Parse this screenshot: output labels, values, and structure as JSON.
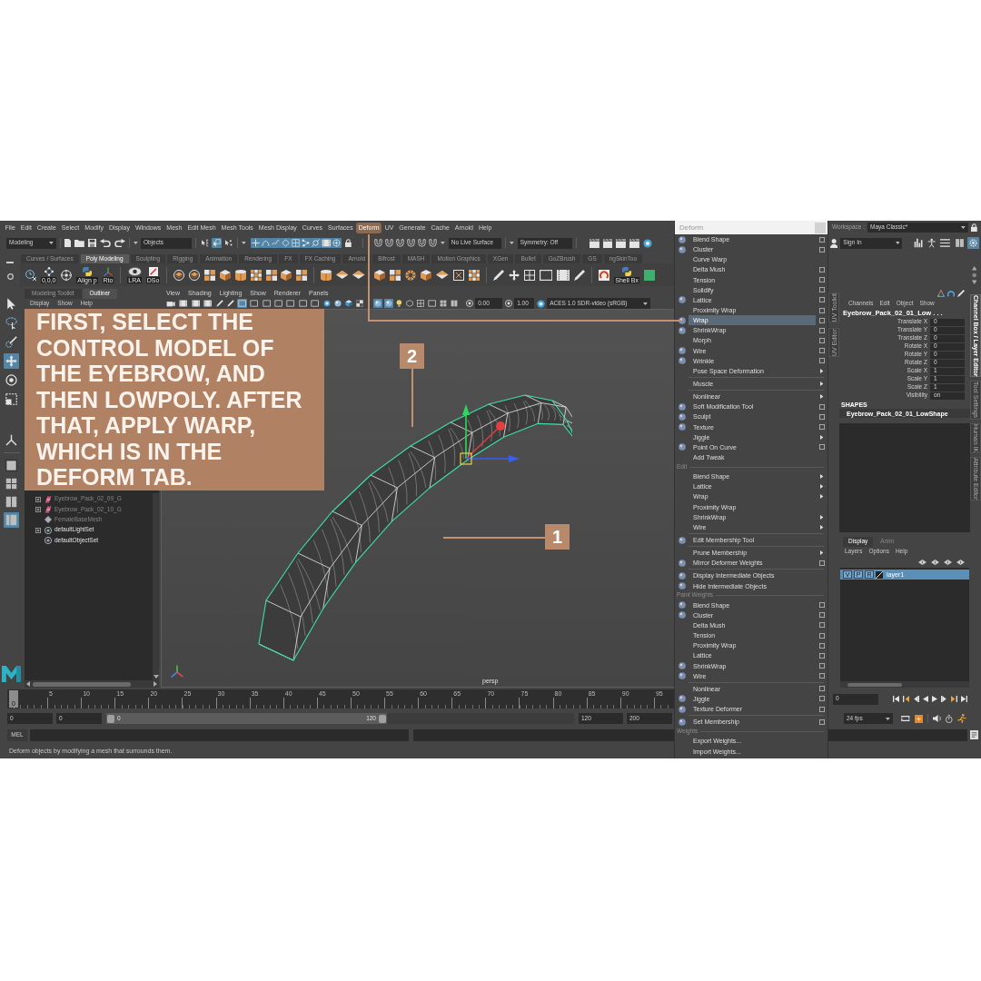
{
  "menu_bar": {
    "items": [
      {
        "label": "File",
        "selected": false
      },
      {
        "label": "Edit",
        "selected": false
      },
      {
        "label": "Create",
        "selected": false
      },
      {
        "label": "Select",
        "selected": false
      },
      {
        "label": "Modify",
        "selected": false
      },
      {
        "label": "Display",
        "selected": false
      },
      {
        "label": "Windows",
        "selected": false
      },
      {
        "label": "Mesh",
        "selected": false
      },
      {
        "label": "Edit Mesh",
        "selected": false
      },
      {
        "label": "Mesh Tools",
        "selected": false
      },
      {
        "label": "Mesh Display",
        "selected": false
      },
      {
        "label": "Curves",
        "selected": false
      },
      {
        "label": "Surfaces",
        "selected": false
      },
      {
        "label": "Deform",
        "selected": true
      },
      {
        "label": "UV",
        "selected": false
      },
      {
        "label": "Generate",
        "selected": false
      },
      {
        "label": "Cache",
        "selected": false
      },
      {
        "label": "Arnold",
        "selected": false
      },
      {
        "label": "Help",
        "selected": false
      }
    ]
  },
  "workspace": {
    "label": "Workspace :",
    "value": "Maya Classic*"
  },
  "status_line": {
    "mode": "Modeling",
    "select_mode": "Objects",
    "pick_modes": [
      {
        "selected": false
      },
      {
        "selected": true
      },
      {
        "selected": false
      }
    ],
    "masks": [
      {
        "on": true
      },
      {
        "on": true
      },
      {
        "on": true
      },
      {
        "on": true
      },
      {
        "on": true
      },
      {
        "on": true
      },
      {
        "on": true
      },
      {
        "on": true
      },
      {
        "on": true
      }
    ],
    "live_surface": "No Live Surface",
    "symmetry": "Symmetry: Off",
    "sign_in": "Sign In",
    "panel_toggles": [
      {
        "on": false
      },
      {
        "on": false
      },
      {
        "on": false
      },
      {
        "on": false
      },
      {
        "on": true
      }
    ]
  },
  "shelf": {
    "tabs": [
      {
        "label": "Curves / Surfaces",
        "selected": false
      },
      {
        "label": "Poly Modeling",
        "selected": true
      },
      {
        "label": "Sculpting",
        "selected": false
      },
      {
        "label": "Rigging",
        "selected": false
      },
      {
        "label": "Animation",
        "selected": false
      },
      {
        "label": "Rendering",
        "selected": false
      },
      {
        "label": "FX",
        "selected": false
      },
      {
        "label": "FX Caching",
        "selected": false
      },
      {
        "label": "Arnold",
        "selected": false
      },
      {
        "label": "Bifrost",
        "selected": false
      },
      {
        "label": "MASH",
        "selected": false
      },
      {
        "label": "Motion Graphics",
        "selected": false
      },
      {
        "label": "XGen",
        "selected": false
      },
      {
        "label": "Bullet",
        "selected": false
      },
      {
        "label": "GoZBrush",
        "selected": false
      },
      {
        "label": "GS",
        "selected": false
      },
      {
        "label": "ngSkinToo",
        "selected": false
      }
    ],
    "tool_labels": [
      "0,0,0",
      "Align p",
      "Rto",
      "LRA",
      "DSo",
      "Shell Bx"
    ]
  },
  "toolbox": {
    "tools": [
      {
        "selected": false
      },
      {
        "selected": false
      },
      {
        "selected": false
      },
      {
        "selected": true
      },
      {
        "selected": false
      },
      {
        "selected": false
      },
      {
        "selected": false
      }
    ],
    "layouts": [
      {
        "selected": false
      },
      {
        "selected": false
      },
      {
        "selected": false
      },
      {
        "selected": true
      }
    ]
  },
  "outliner": {
    "tabs": [
      {
        "label": "Modeling Toolkit",
        "selected": false
      },
      {
        "label": "Outliner",
        "selected": true
      }
    ],
    "menu": [
      "Display",
      "Show",
      "Help"
    ],
    "items": [
      {
        "label": "Eyebrow_Pack_02_09_G",
        "kind": "group",
        "dimmed": true,
        "expanded": false
      },
      {
        "label": "Eyebrow_Pack_02_10_G",
        "kind": "group",
        "dimmed": true,
        "expanded": false
      },
      {
        "label": "FemaleBaseMesh",
        "kind": "mesh",
        "dimmed": true
      },
      {
        "label": "defaultLightSet",
        "kind": "set",
        "dimmed": false,
        "expanded": false
      },
      {
        "label": "defaultObjectSet",
        "kind": "set",
        "dimmed": false
      }
    ]
  },
  "viewport": {
    "menu": [
      "View",
      "Shading",
      "Lighting",
      "Show",
      "Renderer",
      "Panels"
    ],
    "toolbar": [
      {
        "on": false
      },
      {
        "on": false
      },
      {
        "on": false
      },
      {
        "on": false
      },
      {
        "on": false
      },
      {
        "on": false
      },
      {
        "on": true
      },
      {
        "on": false
      },
      {
        "on": false
      },
      {
        "on": false
      },
      {
        "on": false
      },
      {
        "on": false
      },
      {
        "on": false
      },
      {
        "on": false
      },
      {
        "on": false
      },
      {
        "on": false
      },
      {
        "on": false
      },
      {
        "on": true
      },
      {
        "on": true
      },
      {
        "on": false
      },
      {
        "on": false
      },
      {
        "on": false
      },
      {
        "on": false
      },
      {
        "on": false
      },
      {
        "on": false
      }
    ],
    "exposure": "0.00",
    "gamma": "1.00",
    "color_space": "ACES 1.0 SDR-video (sRGB)",
    "camera": "persp"
  },
  "instruction": "FIRST, SELECT THE CONTROL MODEL OF THE EYEBROW, AND THEN LOWPOLY. AFTER THAT, APPLY WARP, WHICH IS IN THE DEFORM TAB.",
  "callouts": [
    {
      "label": "2"
    },
    {
      "label": "1"
    }
  ],
  "deform_menu": {
    "title": "Deform",
    "sections": [
      {
        "groups": [
          {
            "items": [
              {
                "label": "Blend Shape",
                "kind": "option",
                "icon": true,
                "selected": false
              },
              {
                "label": "Cluster",
                "kind": "option",
                "icon": true,
                "selected": false
              },
              {
                "label": "Curve Warp",
                "kind": "action",
                "selected": false
              },
              {
                "label": "Delta Mush",
                "kind": "option",
                "selected": false
              },
              {
                "label": "Tension",
                "kind": "option",
                "selected": false
              },
              {
                "label": "Solidify",
                "kind": "option",
                "selected": false
              },
              {
                "label": "Lattice",
                "kind": "option",
                "icon": true,
                "selected": false
              },
              {
                "label": "Proximity Wrap",
                "kind": "option",
                "selected": false
              },
              {
                "label": "Wrap",
                "kind": "option",
                "icon": true,
                "selected": true
              },
              {
                "label": "ShrinkWrap",
                "kind": "option",
                "icon": true,
                "selected": false
              },
              {
                "label": "Morph",
                "kind": "option",
                "selected": false
              },
              {
                "label": "Wire",
                "kind": "option",
                "icon": true,
                "selected": false
              },
              {
                "label": "Wrinkle",
                "kind": "option",
                "icon": true,
                "selected": false
              },
              {
                "label": "Pose Space Deformation",
                "kind": "submenu",
                "selected": false
              }
            ]
          },
          {
            "items": [
              {
                "label": "Muscle",
                "kind": "submenu",
                "selected": false
              }
            ]
          },
          {
            "items": [
              {
                "label": "Nonlinear",
                "kind": "submenu",
                "selected": false
              },
              {
                "label": "Soft Modification Tool",
                "kind": "option",
                "icon": true,
                "selected": false
              },
              {
                "label": "Sculpt",
                "kind": "option",
                "icon": true,
                "selected": false
              },
              {
                "label": "Texture",
                "kind": "option",
                "icon": true,
                "selected": false
              },
              {
                "label": "Jiggle",
                "kind": "submenu",
                "selected": false
              },
              {
                "label": "Point On Curve",
                "kind": "option",
                "icon": true,
                "selected": false
              },
              {
                "label": "Add Tweak",
                "kind": "action",
                "selected": false
              }
            ]
          }
        ]
      },
      {
        "heading": "Edit",
        "groups": [
          {
            "items": [
              {
                "label": "Blend Shape",
                "kind": "submenu",
                "selected": false
              },
              {
                "label": "Lattice",
                "kind": "submenu",
                "selected": false
              },
              {
                "label": "Wrap",
                "kind": "submenu",
                "selected": false
              },
              {
                "label": "Proximity Wrap",
                "kind": "action",
                "selected": false
              },
              {
                "label": "ShrinkWrap",
                "kind": "submenu",
                "selected": false
              },
              {
                "label": "Wire",
                "kind": "submenu",
                "selected": false
              }
            ]
          },
          {
            "items": [
              {
                "label": "Edit Membership Tool",
                "kind": "action",
                "icon": true,
                "selected": false
              }
            ]
          },
          {
            "items": [
              {
                "label": "Prune Membership",
                "kind": "submenu",
                "selected": false
              },
              {
                "label": "Mirror Deformer Weights",
                "kind": "option",
                "icon": true,
                "selected": false
              }
            ]
          },
          {
            "items": [
              {
                "label": "Display Intermediate Objects",
                "kind": "action",
                "icon": true,
                "selected": false
              },
              {
                "label": "Hide Intermediate Objects",
                "kind": "action",
                "icon": true,
                "selected": false
              }
            ]
          }
        ]
      },
      {
        "heading": "Paint Weights",
        "groups": [
          {
            "items": [
              {
                "label": "Blend Shape",
                "kind": "option",
                "icon": true,
                "selected": false
              },
              {
                "label": "Cluster",
                "kind": "option",
                "icon": true,
                "selected": false
              },
              {
                "label": "Delta Mush",
                "kind": "option",
                "selected": false
              },
              {
                "label": "Tension",
                "kind": "option",
                "selected": false
              },
              {
                "label": "Proximity Wrap",
                "kind": "option",
                "selected": false
              },
              {
                "label": "Lattice",
                "kind": "option",
                "selected": false
              },
              {
                "label": "ShrinkWrap",
                "kind": "option",
                "icon": true,
                "selected": false
              },
              {
                "label": "Wire",
                "kind": "option",
                "icon": true,
                "selected": false
              }
            ]
          },
          {
            "items": [
              {
                "label": "Nonlinear",
                "kind": "option",
                "selected": false
              },
              {
                "label": "Jiggle",
                "kind": "option",
                "icon": true,
                "selected": false
              },
              {
                "label": "Texture Deformer",
                "kind": "option",
                "icon": true,
                "selected": false
              }
            ]
          },
          {
            "items": [
              {
                "label": "Set Membership",
                "kind": "option",
                "icon": true,
                "selected": false
              }
            ]
          }
        ]
      },
      {
        "heading": "Weights",
        "groups": [
          {
            "items": [
              {
                "label": "Export Weights...",
                "kind": "action",
                "selected": false
              },
              {
                "label": "Import Weights...",
                "kind": "action",
                "selected": false
              }
            ]
          }
        ]
      }
    ]
  },
  "channel_box": {
    "left_tabs": [
      {
        "label": "UV Toolkit",
        "selected": false
      },
      {
        "label": "UV Editor",
        "selected": false
      }
    ],
    "right_tabs": [
      {
        "label": "Channel Box / Layer Editor",
        "selected": true
      },
      {
        "label": "Tool Settings",
        "selected": false
      },
      {
        "label": "Human IK",
        "selected": false
      },
      {
        "label": "Attribute Editor",
        "selected": false
      }
    ],
    "menu": [
      "Channels",
      "Edit",
      "Object",
      "Show"
    ],
    "object": "Eyebrow_Pack_02_01_Low . . .",
    "attributes": [
      {
        "name": "Translate X",
        "value": "0"
      },
      {
        "name": "Translate Y",
        "value": "0"
      },
      {
        "name": "Translate Z",
        "value": "0"
      },
      {
        "name": "Rotate X",
        "value": "0"
      },
      {
        "name": "Rotate Y",
        "value": "0"
      },
      {
        "name": "Rotate Z",
        "value": "0"
      },
      {
        "name": "Scale X",
        "value": "1"
      },
      {
        "name": "Scale Y",
        "value": "1"
      },
      {
        "name": "Scale Z",
        "value": "1"
      },
      {
        "name": "Visibility",
        "value": "on"
      }
    ],
    "shapes_heading": "SHAPES",
    "shape": "Eyebrow_Pack_02_01_LowShape"
  },
  "layer_editor": {
    "tabs": [
      {
        "label": "Display",
        "selected": true
      },
      {
        "label": "Anim",
        "selected": false
      }
    ],
    "menu": [
      "Layers",
      "Options",
      "Help"
    ],
    "layers": [
      {
        "name": "layer1",
        "selected": true,
        "toggles": [
          "V",
          "P",
          "R"
        ]
      }
    ]
  },
  "time_slider": {
    "current_frame": "0",
    "level": 0,
    "labels": [
      "5",
      "10",
      "15",
      "20",
      "25",
      "30",
      "35",
      "40",
      "45",
      "50",
      "55",
      "60",
      "65",
      "70",
      "75",
      "80",
      "85",
      "90",
      "95"
    ],
    "frame_field": "0"
  },
  "range_slider": {
    "start_field": "0",
    "playback_start_field": "0",
    "level": 0.6,
    "range_start": "0",
    "range_end": "120",
    "playback_end_field": "120",
    "end_field": "200",
    "fps": "24 fps"
  },
  "command_line": {
    "language": "MEL"
  },
  "help_line": "Deform objects by modifying a mesh that surrounds them."
}
